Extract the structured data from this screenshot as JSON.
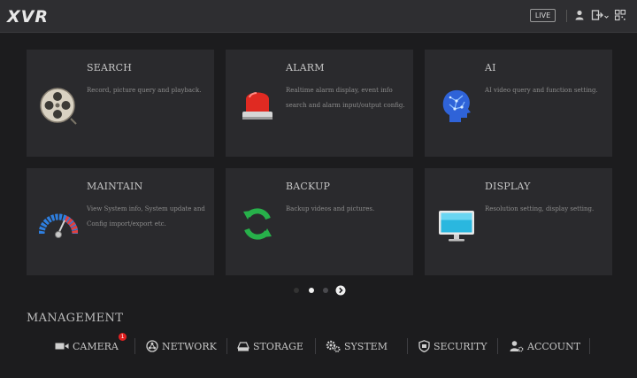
{
  "topbar": {
    "logo": "XVR",
    "live_label": "LIVE"
  },
  "tiles": [
    {
      "title": "SEARCH",
      "desc": "Record, picture query and playback.",
      "icon": "film-reel-icon"
    },
    {
      "title": "ALARM",
      "desc": "Realtime alarm display, event info search and alarm input/output config.",
      "icon": "alarm-siren-icon"
    },
    {
      "title": "AI",
      "desc": "AI video query and function setting.",
      "icon": "ai-head-icon"
    },
    {
      "title": "MAINTAIN",
      "desc": "View System info, System update and Config import/export etc.",
      "icon": "gauge-icon"
    },
    {
      "title": "BACKUP",
      "desc": "Backup videos and pictures.",
      "icon": "refresh-arrows-icon"
    },
    {
      "title": "DISPLAY",
      "desc": "Resolution setting, display setting.",
      "icon": "monitor-icon"
    }
  ],
  "pager": {
    "pages": 3,
    "active": 1
  },
  "management": {
    "title": "MANAGEMENT",
    "items": [
      {
        "label": "CAMERA",
        "icon": "camera-icon",
        "badge": "1"
      },
      {
        "label": "NETWORK",
        "icon": "network-icon"
      },
      {
        "label": "STORAGE",
        "icon": "storage-icon"
      },
      {
        "label": "SYSTEM",
        "icon": "gears-icon"
      },
      {
        "label": "SECURITY",
        "icon": "shield-icon"
      },
      {
        "label": "ACCOUNT",
        "icon": "account-icon"
      }
    ]
  },
  "colors": {
    "background": "#1c1c1e",
    "tile": "#2a2a2d",
    "topbar": "#2e2e31",
    "badge": "#e02020",
    "backup_green": "#27b04a",
    "alarm_red": "#e02a22"
  }
}
